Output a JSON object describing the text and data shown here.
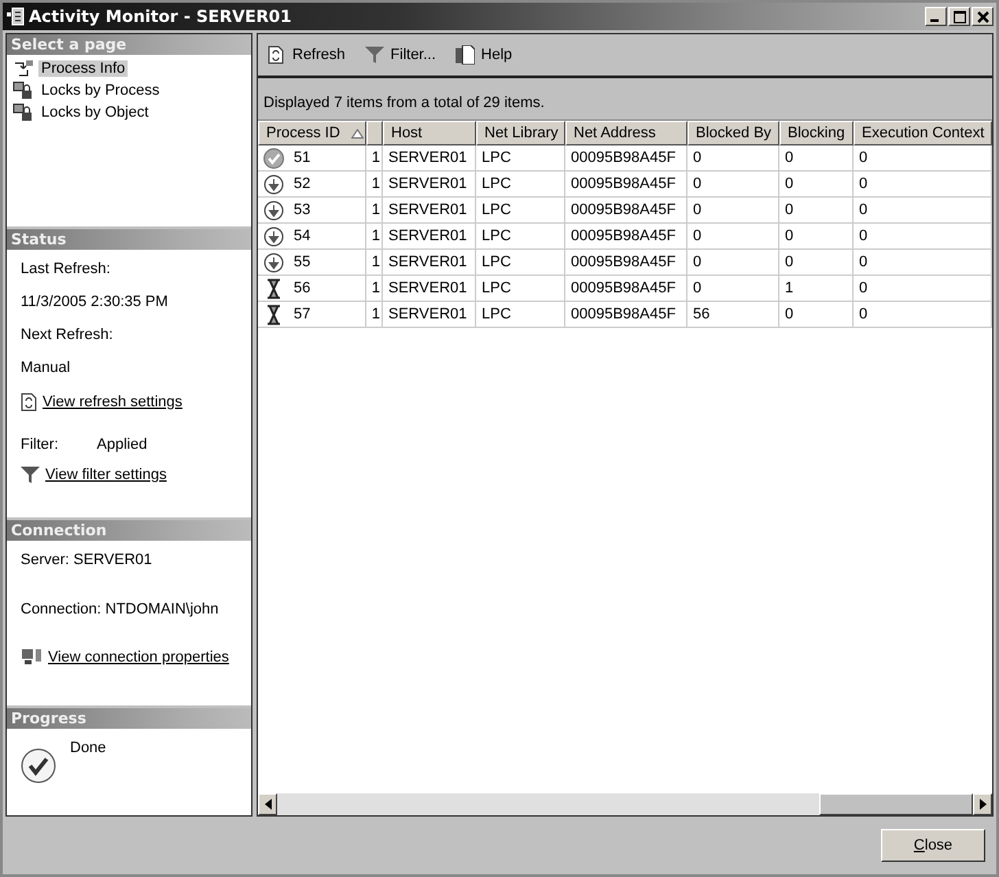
{
  "window": {
    "title": "Activity Monitor - SERVER01"
  },
  "sidebar": {
    "pages_header": "Select a page",
    "pages": [
      {
        "label": "Process Info",
        "selected": true,
        "kind": "process"
      },
      {
        "label": "Locks by Process",
        "selected": false,
        "kind": "locks"
      },
      {
        "label": "Locks by Object",
        "selected": false,
        "kind": "locks"
      }
    ],
    "status_header": "Status",
    "last_refresh_label": "Last Refresh:",
    "last_refresh": "11/3/2005 2:30:35 PM",
    "next_refresh_label": "Next Refresh:",
    "next_refresh": "Manual",
    "refresh_link": "View refresh settings",
    "filter_label": "Filter:",
    "filter_value": "Applied",
    "filter_link": "View filter settings",
    "connection_header": "Connection",
    "server": "Server: SERVER01",
    "connection": "Connection:  NTDOMAIN\\john",
    "connection_link": "View connection properties",
    "progress_header": "Progress",
    "progress": "Done"
  },
  "toolbar": [
    {
      "label": "Refresh",
      "kind": "refresh"
    },
    {
      "label": "Filter...",
      "kind": "filter"
    },
    {
      "label": "Help",
      "kind": "help"
    }
  ],
  "summary": "Displayed 7 items from a total of 29 items.",
  "table": {
    "columns": [
      "Process ID",
      "",
      "Host",
      "Net Library",
      "Net Address",
      "Blocked By",
      "Blocking",
      "Execution Context"
    ],
    "rows": [
      {
        "kind": "check",
        "cells": [
          "51",
          "1",
          "SERVER01",
          "LPC",
          "00095B98A45F",
          "0",
          "0",
          "0"
        ]
      },
      {
        "kind": "arrow",
        "cells": [
          "52",
          "1",
          "SERVER01",
          "LPC",
          "00095B98A45F",
          "0",
          "0",
          "0"
        ]
      },
      {
        "kind": "arrow",
        "cells": [
          "53",
          "1",
          "SERVER01",
          "LPC",
          "00095B98A45F",
          "0",
          "0",
          "0"
        ]
      },
      {
        "kind": "arrow",
        "cells": [
          "54",
          "1",
          "SERVER01",
          "LPC",
          "00095B98A45F",
          "0",
          "0",
          "0"
        ]
      },
      {
        "kind": "arrow",
        "cells": [
          "55",
          "1",
          "SERVER01",
          "LPC",
          "00095B98A45F",
          "0",
          "0",
          "0"
        ]
      },
      {
        "kind": "hourglass",
        "cells": [
          "56",
          "1",
          "SERVER01",
          "LPC",
          "00095B98A45F",
          "0",
          "1",
          "0"
        ]
      },
      {
        "kind": "hourglass",
        "cells": [
          "57",
          "1",
          "SERVER01",
          "LPC",
          "00095B98A45F",
          "56",
          "0",
          "0"
        ]
      }
    ]
  },
  "buttons": [
    "Close"
  ]
}
